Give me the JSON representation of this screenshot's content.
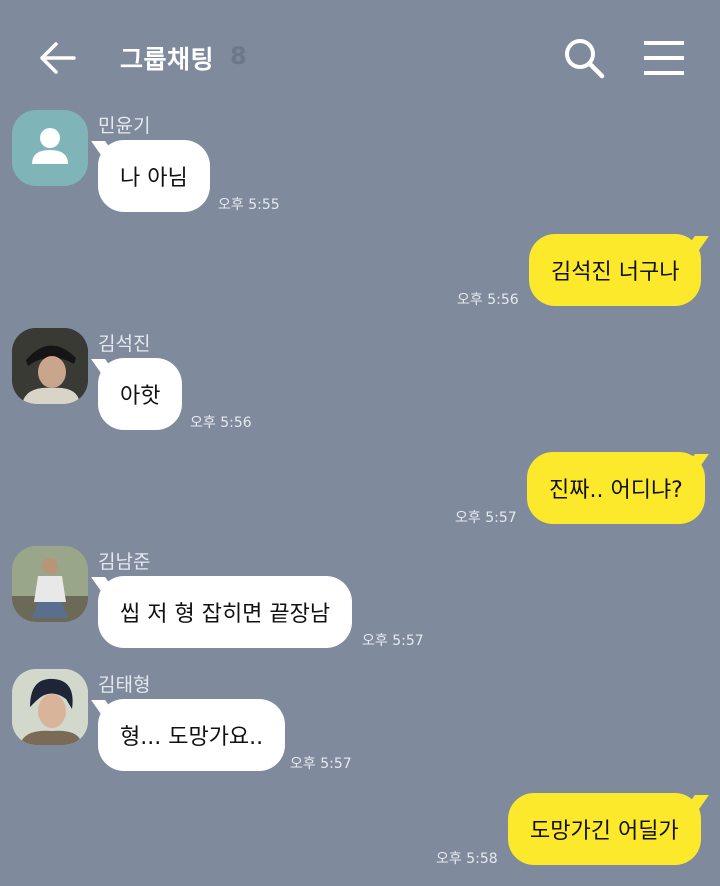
{
  "header": {
    "title": "그룹채팅",
    "member_count": "8"
  },
  "messages": [
    {
      "sender": "민윤기",
      "text": "나 아님",
      "time": "오후 5:55"
    },
    {
      "text": "김석진 너구나",
      "time": "오후 5:56"
    },
    {
      "sender": "김석진",
      "text": "아핫",
      "time": "오후 5:56"
    },
    {
      "text": "진짜.. 어디냐?",
      "time": "오후 5:57"
    },
    {
      "sender": "김남준",
      "text": "씹 저 형 잡히면 끝장남",
      "time": "오후 5:57"
    },
    {
      "sender": "김태형",
      "text": "형... 도망가요..",
      "time": "오후 5:57"
    },
    {
      "text": "도망가긴 어딜가",
      "time": "오후 5:58"
    }
  ],
  "colors": {
    "background": "#7f8a9c",
    "my_bubble": "#fde92c",
    "other_bubble": "#ffffff"
  }
}
